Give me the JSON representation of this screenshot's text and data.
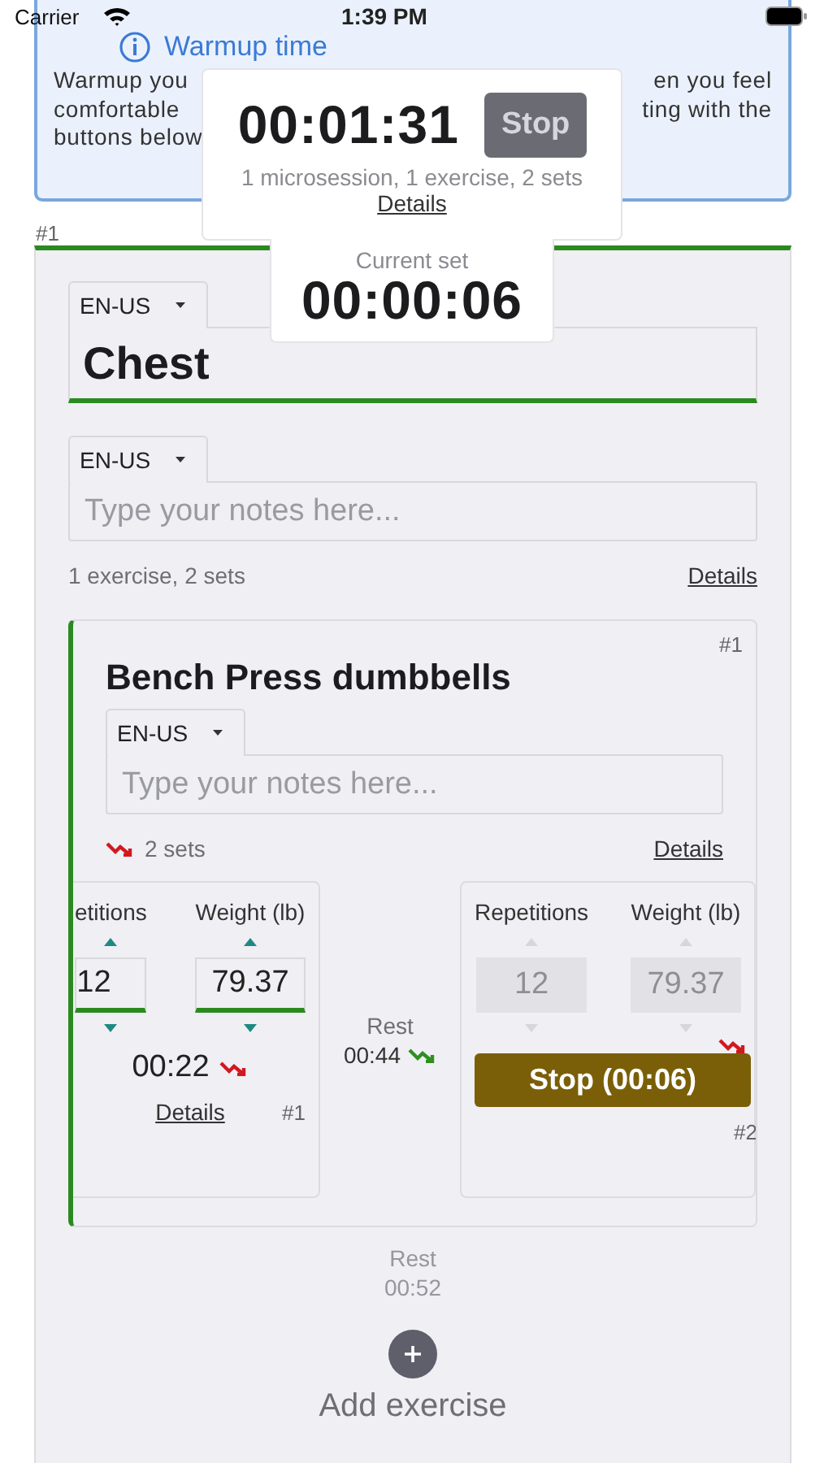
{
  "status_bar": {
    "carrier": "Carrier",
    "time": "1:39 PM"
  },
  "warmup": {
    "title": "Warmup time",
    "lines": [
      {
        "left": "Warmup you",
        "right": "en you feel"
      },
      {
        "left": "comfortable",
        "right": "ting with the"
      },
      {
        "left": "buttons below"
      }
    ]
  },
  "timer_popup": {
    "elapsed": "00:01:31",
    "stop_button": "Stop",
    "summary": "1 microsession, 1 exercise, 2 sets",
    "details_link": "Details",
    "current_set_label": "Current set",
    "current_set_time": "00:00:06"
  },
  "microsession": {
    "number": "#1",
    "language": "EN-US",
    "name": "Chest",
    "notes_language": "EN-US",
    "notes_placeholder": "Type your notes here...",
    "summary": "1 exercise, 2 sets",
    "details_link": "Details",
    "exercises": [
      {
        "number": "#1",
        "name": "Bench Press dumbbells",
        "language": "EN-US",
        "notes_placeholder": "Type your notes here...",
        "summary": "2 sets",
        "trend_icon": {
          "color": "#d0191f"
        },
        "details_link": "Details",
        "sets": [
          {
            "kind": "done",
            "reps_label": "etitions",
            "weight_label": "Weight (lb)",
            "reps": "12",
            "weight": "79.37",
            "disabled": false,
            "duration": "00:22",
            "trend_icon": {
              "color": "#d0191f"
            },
            "details_link": "Details",
            "number": "#1"
          },
          {
            "kind": "rest",
            "label": "Rest",
            "time": "00:44",
            "trend_icon": {
              "color": "#2f8f1f"
            }
          },
          {
            "kind": "running",
            "reps_label": "Repetitions",
            "weight_label": "Weight (lb)",
            "reps": "12",
            "weight": "79.37",
            "disabled": true,
            "trend_icon": {
              "color": "#d0191f"
            },
            "stop_button": "Stop (00:06)",
            "number": "#2"
          }
        ]
      }
    ],
    "pending_rest": {
      "label": "Rest",
      "time": "00:52"
    },
    "add_exercise": "Add exercise"
  }
}
